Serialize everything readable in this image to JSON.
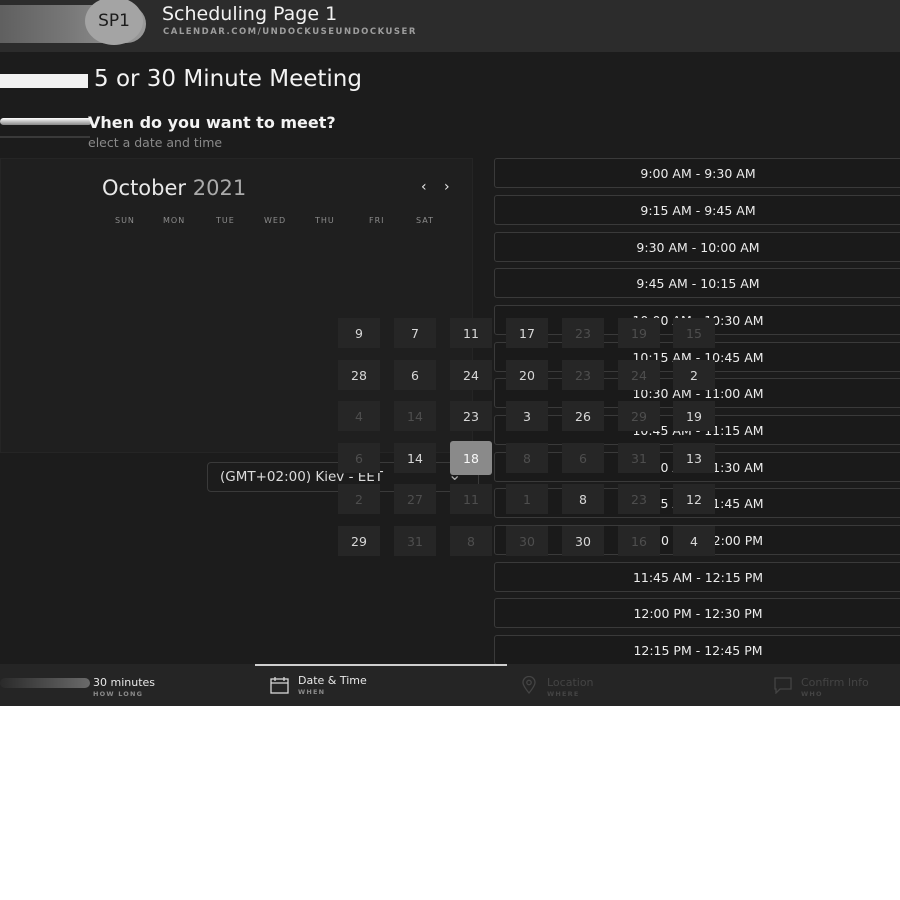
{
  "header": {
    "avatar_initials": "SP1",
    "title": "Scheduling Page 1",
    "url": "CALENDAR.COM/UNDOCKUSEUNDOCKUSER"
  },
  "meeting": {
    "title": "5 or 30 Minute Meeting",
    "question": "Vhen do you want to meet?",
    "subtitle": "elect a date and time"
  },
  "calendar": {
    "month": "October",
    "year": "2021",
    "prev_icon": "chevron-left-icon",
    "next_icon": "chevron-right-icon",
    "prev_glyph": "‹",
    "next_glyph": "›",
    "weekdays": [
      "SUN",
      "MON",
      "TUE",
      "WED",
      "THU",
      "FRI",
      "SAT"
    ],
    "day_rows": [
      [
        {
          "t": "9"
        },
        {
          "t": "7"
        },
        {
          "t": "11"
        },
        {
          "t": "17"
        },
        {
          "t": "23",
          "dim": true
        },
        {
          "t": "19",
          "dim": true
        },
        {
          "t": "15",
          "dim": true
        }
      ],
      [
        {
          "t": "28"
        },
        {
          "t": "6"
        },
        {
          "t": "24"
        },
        {
          "t": "20"
        },
        {
          "t": "23",
          "dim": true
        },
        {
          "t": "24",
          "dim": true
        },
        {
          "t": "2"
        }
      ],
      [
        {
          "t": "4",
          "dim": true
        },
        {
          "t": "14",
          "dim": true
        },
        {
          "t": "23"
        },
        {
          "t": "3"
        },
        {
          "t": "26"
        },
        {
          "t": "29",
          "dim": true
        },
        {
          "t": "19"
        }
      ],
      [
        {
          "t": "6",
          "dim": true
        },
        {
          "t": "14"
        },
        {
          "t": "18",
          "sel": true
        },
        {
          "t": "8",
          "dim": true
        },
        {
          "t": "6",
          "dim": true
        },
        {
          "t": "31",
          "dim": true
        },
        {
          "t": "13"
        }
      ],
      [
        {
          "t": "2",
          "dim": true
        },
        {
          "t": "27",
          "dim": true
        },
        {
          "t": "11",
          "dim": true
        },
        {
          "t": "1",
          "dim": true
        },
        {
          "t": "8"
        },
        {
          "t": "23",
          "dim": true
        },
        {
          "t": "12"
        }
      ],
      [
        {
          "t": "29"
        },
        {
          "t": "31",
          "dim": true
        },
        {
          "t": "8",
          "dim": true
        },
        {
          "t": "30",
          "dim": true
        },
        {
          "t": "30"
        },
        {
          "t": "16",
          "dim": true
        },
        {
          "t": "4"
        }
      ]
    ]
  },
  "timezone": {
    "value": "(GMT+02:00) Kiev - EET",
    "icon": "chevron-down-icon"
  },
  "time_slots": [
    "9:00 AM - 9:30 AM",
    "9:15 AM - 9:45 AM",
    "9:30 AM - 10:00 AM",
    "9:45 AM - 10:15 AM",
    "10:00 AM - 10:30 AM",
    "10:15 AM - 10:45 AM",
    "10:30 AM - 11:00 AM",
    "10:45 AM - 11:15 AM",
    "11:00 AM - 11:30 AM",
    "11:15 AM - 11:45 AM",
    "11:30 AM - 12:00 PM",
    "11:45 AM - 12:15 PM",
    "12:00 PM - 12:30 PM",
    "12:15 PM - 12:45 PM"
  ],
  "tabs": {
    "duration": {
      "main": "30 minutes",
      "sub": "HOW LONG"
    },
    "date_time": {
      "main": "Date & Time",
      "sub": "WHEN",
      "icon": "calendar-icon"
    },
    "location": {
      "main": "Location",
      "sub": "WHERE",
      "icon": "location-pin-icon"
    },
    "confirm": {
      "main": "Confirm Info",
      "sub": "WHO",
      "icon": "chat-icon"
    }
  }
}
